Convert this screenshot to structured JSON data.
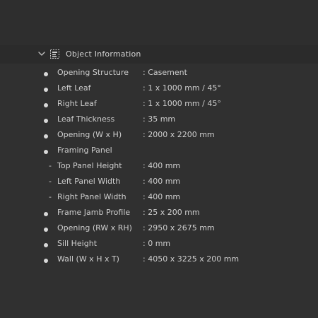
{
  "panel": {
    "title": "Object Information",
    "expanded": true,
    "chevron_icon": "chevron-down-icon",
    "header_icon": "object-info-icon"
  },
  "rows": [
    {
      "marker": "bullet",
      "label": "Opening Structure",
      "value": ": Casement"
    },
    {
      "marker": "bullet",
      "label": "Left Leaf",
      "value": ": 1 x 1000 mm / 45°"
    },
    {
      "marker": "bullet",
      "label": "Right Leaf",
      "value": ": 1 x 1000 mm / 45°"
    },
    {
      "marker": "bullet",
      "label": "Leaf Thickness",
      "value": ": 35 mm"
    },
    {
      "marker": "bullet",
      "label": "Opening (W x H)",
      "value": ": 2000 x 2200 mm"
    },
    {
      "marker": "bullet",
      "label": "Framing Panel",
      "value": ""
    },
    {
      "marker": "dash",
      "label": "Top Panel Height",
      "value": ": 400 mm"
    },
    {
      "marker": "dash",
      "label": "Left Panel Width",
      "value": ": 400 mm"
    },
    {
      "marker": "dash",
      "label": "Right Panel Width",
      "value": ": 400 mm"
    },
    {
      "marker": "bullet",
      "label": "Frame Jamb Profile",
      "value": ": 25 x 200 mm"
    },
    {
      "marker": "bullet",
      "label": "Opening (RW x RH)",
      "value": ": 2950 x 2675 mm"
    },
    {
      "marker": "bullet",
      "label": "Sill Height",
      "value": ": 0 mm"
    },
    {
      "marker": "bullet",
      "label": "Wall (W x H x T)",
      "value": ": 4050 x 3225 x 200 mm"
    }
  ],
  "dash_glyph": "-",
  "colors": {
    "background": "#303030",
    "header_background": "#2b2b2b",
    "text": "#cfcfcf",
    "bullet": "#d8d8d8"
  }
}
